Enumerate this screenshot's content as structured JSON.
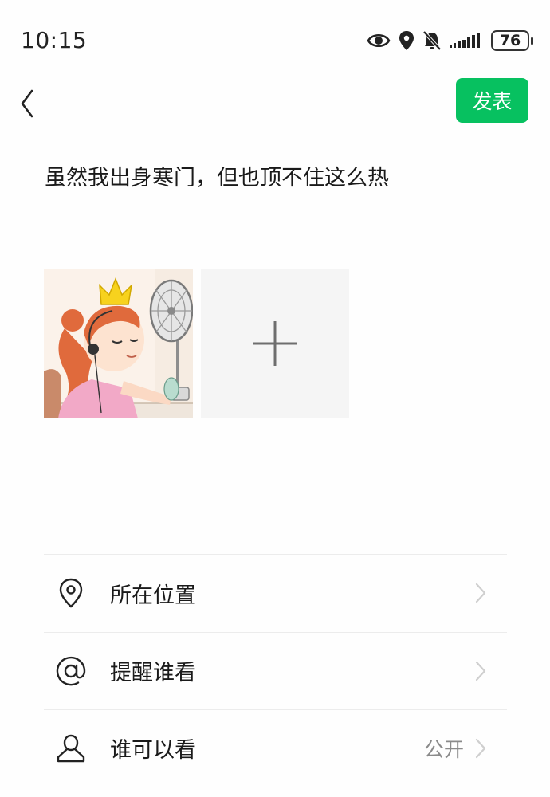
{
  "status_bar": {
    "time": "10:15",
    "battery": "76",
    "icons": [
      "eye-icon",
      "location-icon",
      "bell-muted-icon",
      "signal-icon",
      "battery-icon"
    ]
  },
  "nav": {
    "back_icon": "chevron-left-icon",
    "publish_label": "发表",
    "accent_color": "#07c160"
  },
  "post": {
    "text": "虽然我出身寒门，但也顶不住这么热"
  },
  "photos": {
    "items": [
      {
        "description_icon": "cartoon-girl-fan-image"
      }
    ],
    "add_icon": "plus-icon"
  },
  "menu": {
    "items": [
      {
        "icon": "location-pin-icon",
        "label": "所在位置",
        "value": ""
      },
      {
        "icon": "at-sign-icon",
        "label": "提醒谁看",
        "value": ""
      },
      {
        "icon": "person-icon",
        "label": "谁可以看",
        "value": "公开"
      }
    ]
  }
}
